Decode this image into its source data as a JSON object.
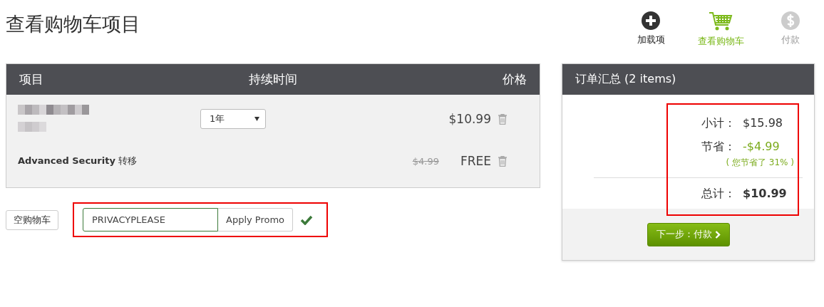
{
  "page_title": "查看购物车项目",
  "steps": [
    {
      "label": "加载项",
      "kind": "done"
    },
    {
      "label": "查看购物车",
      "kind": "current"
    },
    {
      "label": "付款",
      "kind": "upcoming"
    }
  ],
  "cart_table": {
    "columns": [
      "项目",
      "持续时间",
      "价格"
    ],
    "rows": [
      {
        "kind": "product",
        "duration": "1年",
        "price": "$10.99"
      },
      {
        "kind": "addon",
        "name": "**Advanced Security** 转移",
        "old_price": "$4.99",
        "price": "FREE"
      }
    ]
  },
  "empty_cart_button": "空购物车",
  "promo": {
    "value": "PRIVACYPLEASE",
    "button": "Apply Promo",
    "applied": true
  },
  "summary": {
    "title": "订单汇总 (2 items)",
    "subtotal": {
      "label": "小计：",
      "value": "$15.98"
    },
    "savings": {
      "label": "节省：",
      "value": "-$4.99",
      "note": "( 您节省了 31% )"
    },
    "total": {
      "label": "总计：",
      "value": "$10.99"
    },
    "next_button": "下一步：付款"
  }
}
